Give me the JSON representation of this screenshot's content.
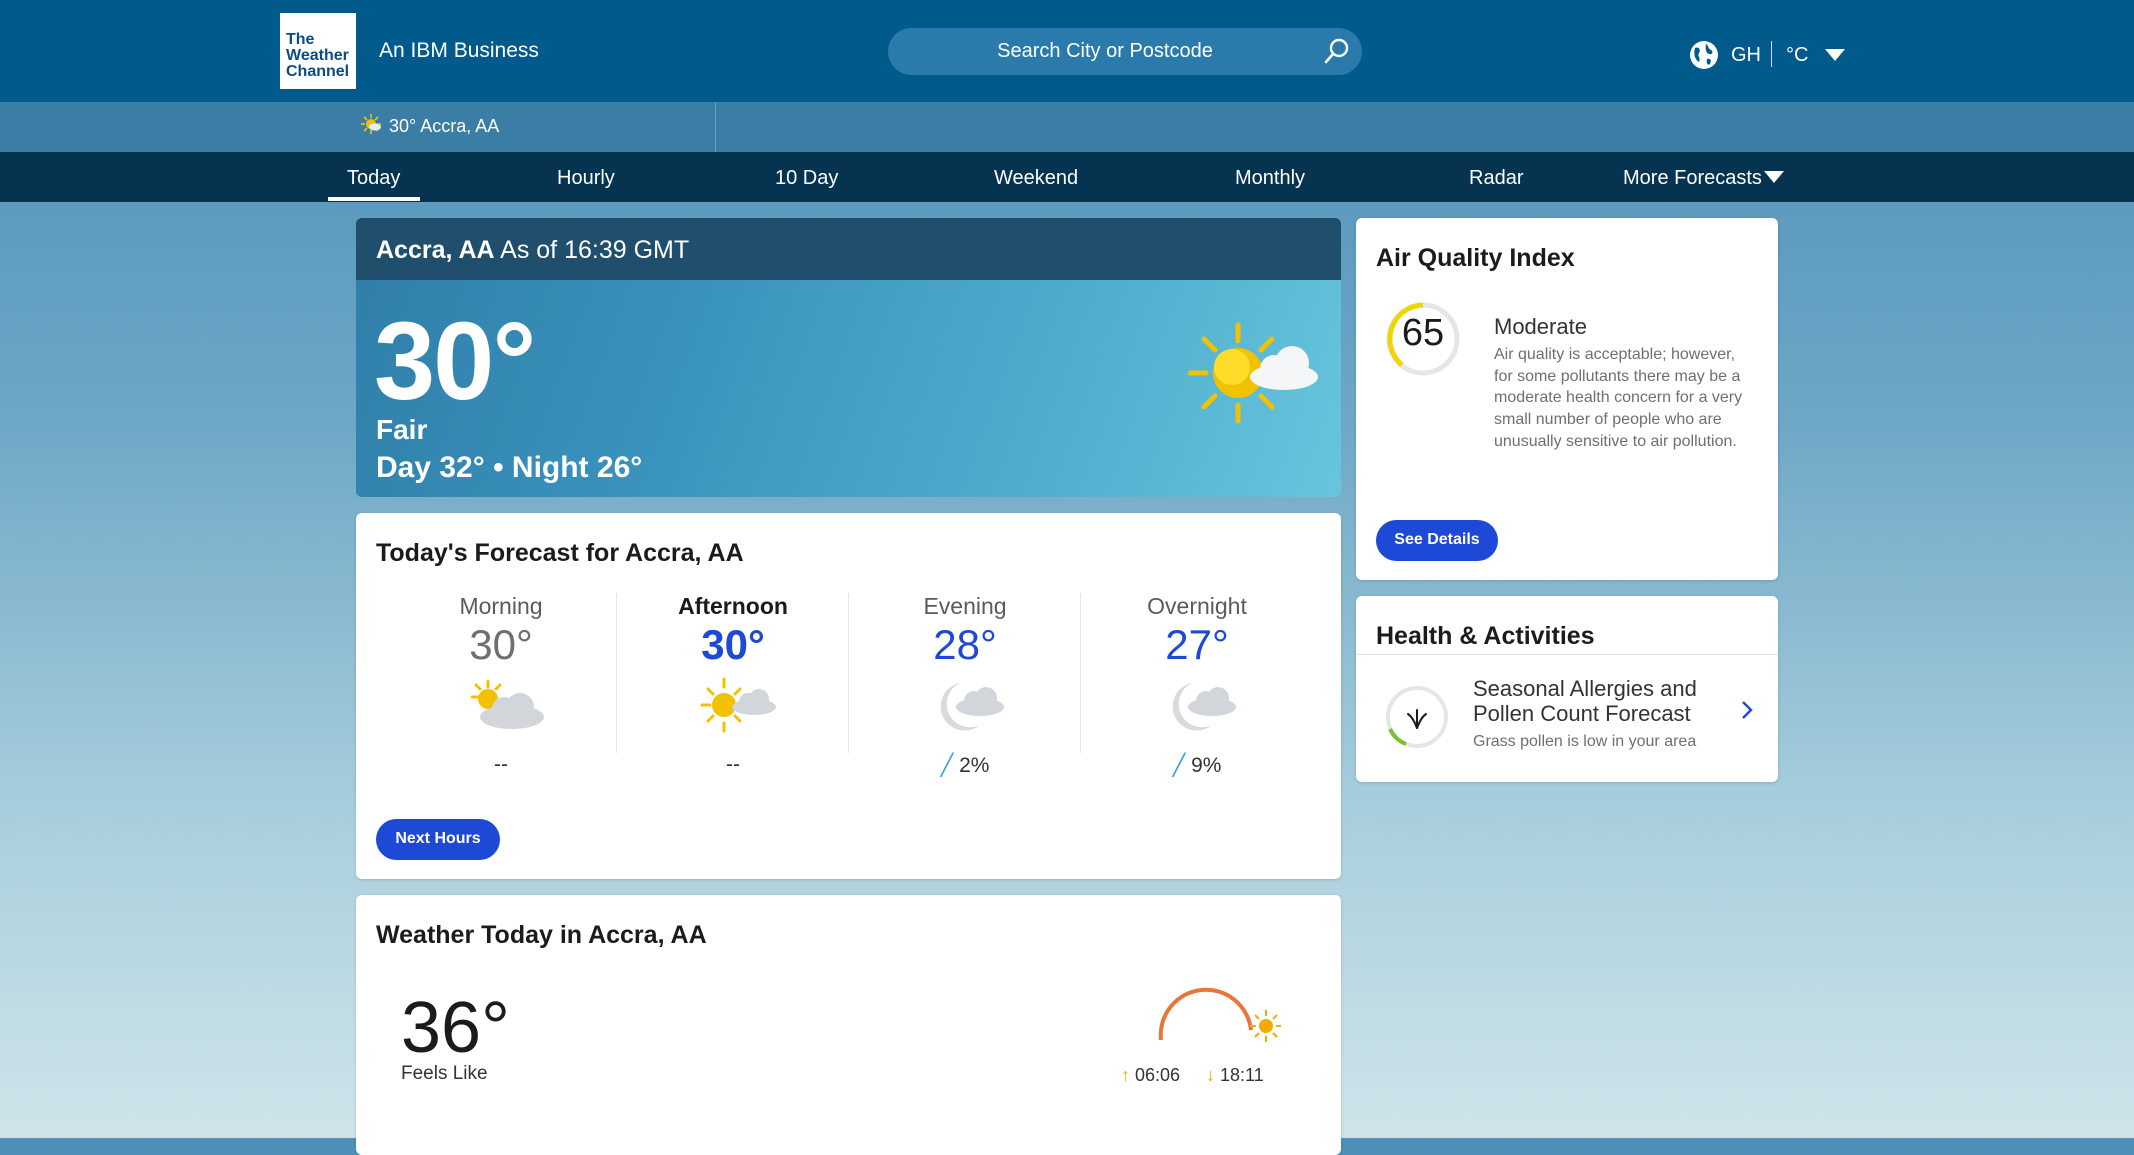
{
  "header": {
    "brand_lines": [
      "The",
      "Weather",
      "Channel"
    ],
    "tagline": "An IBM Business",
    "search_placeholder": "Search City or Postcode",
    "locale_country": "GH",
    "locale_unit": "°C"
  },
  "recent": {
    "text": "30° Accra, AA"
  },
  "nav": {
    "items": [
      {
        "label": "Today",
        "active": true
      },
      {
        "label": "Hourly"
      },
      {
        "label": "10 Day"
      },
      {
        "label": "Weekend"
      },
      {
        "label": "Monthly"
      },
      {
        "label": "Radar"
      },
      {
        "label": "More Forecasts"
      }
    ]
  },
  "current": {
    "location": "Accra, AA",
    "as_of": "As of 16:39 GMT",
    "temp": "30°",
    "phrase": "Fair",
    "day_night": "Day 32° • Night 26°",
    "icon": "partly-sunny-icon"
  },
  "today_forecast": {
    "title": "Today's Forecast for Accra, AA",
    "periods": [
      {
        "name": "Morning",
        "temp": "30°",
        "precip": "--",
        "icon": "partly-sunny-icon",
        "active": false
      },
      {
        "name": "Afternoon",
        "temp": "30°",
        "precip": "--",
        "icon": "partly-sunny-icon",
        "active": true
      },
      {
        "name": "Evening",
        "temp": "28°",
        "precip": "2%",
        "icon": "partly-cloudy-night-icon",
        "active": false
      },
      {
        "name": "Overnight",
        "temp": "27°",
        "precip": "9%",
        "icon": "partly-cloudy-night-icon",
        "active": false
      }
    ],
    "button": "Next Hours"
  },
  "air_quality": {
    "title": "Air Quality Index",
    "value": "65",
    "category": "Moderate",
    "description": "Air quality is acceptable; however, for some pollutants there may be a moderate health concern for a very small number of people who are unusually sensitive to air pollution.",
    "button": "See Details",
    "color": "#ffd500"
  },
  "health": {
    "title": "Health & Activities",
    "item_title": "Seasonal Allergies and Pollen Count Forecast",
    "item_sub": "Grass pollen is low in your area",
    "color": "#79c12f"
  },
  "weather_today": {
    "title": "Weather Today in Accra, AA",
    "feels_like": "36°",
    "feels_like_label": "Feels Like",
    "sunrise": "06:06",
    "sunset": "18:11"
  },
  "colors": {
    "header": "#005a8c",
    "nav": "#053350",
    "accent": "#1e48d6"
  }
}
